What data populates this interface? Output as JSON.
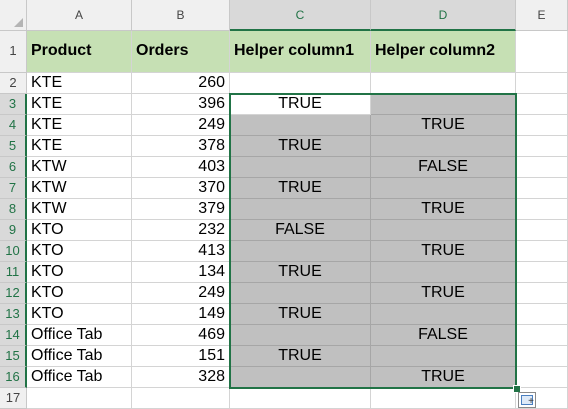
{
  "columns": [
    "A",
    "B",
    "C",
    "D",
    "E"
  ],
  "rows": [
    "1",
    "2",
    "3",
    "4",
    "5",
    "6",
    "7",
    "8",
    "9",
    "10",
    "11",
    "12",
    "13",
    "14",
    "15",
    "16",
    "17"
  ],
  "headers": {
    "product": "Product",
    "orders": "Orders",
    "helper1": "Helper column1",
    "helper2": "Helper column2"
  },
  "data": [
    {
      "product": "KTE",
      "orders": "260",
      "h1": "",
      "h2": ""
    },
    {
      "product": "KTE",
      "orders": "396",
      "h1": "TRUE",
      "h2": ""
    },
    {
      "product": "KTE",
      "orders": "249",
      "h1": "",
      "h2": "TRUE"
    },
    {
      "product": "KTE",
      "orders": "378",
      "h1": "TRUE",
      "h2": ""
    },
    {
      "product": "KTW",
      "orders": "403",
      "h1": "",
      "h2": "FALSE"
    },
    {
      "product": "KTW",
      "orders": "370",
      "h1": "TRUE",
      "h2": ""
    },
    {
      "product": "KTW",
      "orders": "379",
      "h1": "",
      "h2": "TRUE"
    },
    {
      "product": "KTO",
      "orders": "232",
      "h1": "FALSE",
      "h2": ""
    },
    {
      "product": "KTO",
      "orders": "413",
      "h1": "",
      "h2": "TRUE"
    },
    {
      "product": "KTO",
      "orders": "134",
      "h1": "TRUE",
      "h2": ""
    },
    {
      "product": "KTO",
      "orders": "249",
      "h1": "",
      "h2": "TRUE"
    },
    {
      "product": "KTO",
      "orders": "149",
      "h1": "TRUE",
      "h2": ""
    },
    {
      "product": "Office Tab",
      "orders": "469",
      "h1": "",
      "h2": "FALSE"
    },
    {
      "product": "Office Tab",
      "orders": "151",
      "h1": "TRUE",
      "h2": ""
    },
    {
      "product": "Office Tab",
      "orders": "328",
      "h1": "",
      "h2": "TRUE"
    }
  ],
  "colors": {
    "header_fill": "#c6e0b4",
    "selection_fill": "#c0c0c0",
    "selection_border": "#217346"
  }
}
